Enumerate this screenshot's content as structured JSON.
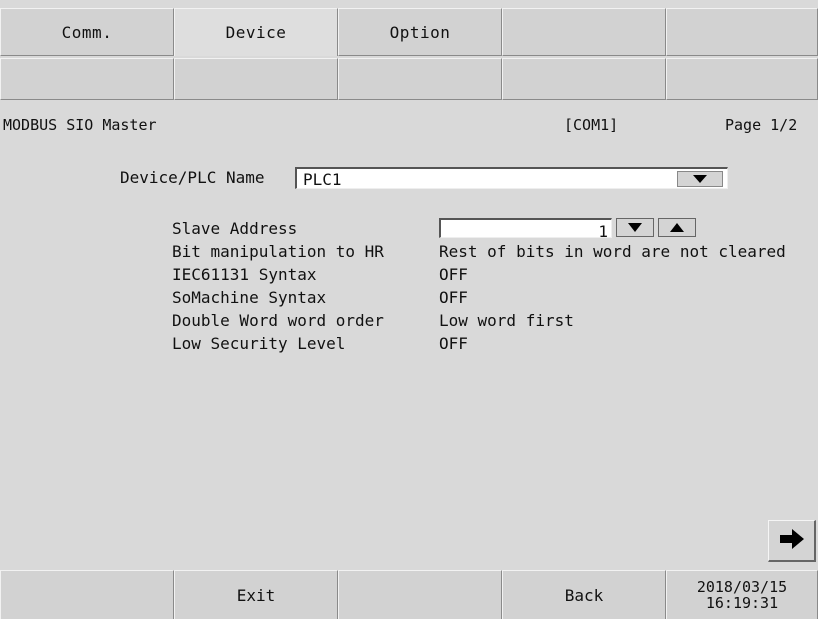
{
  "tabs": [
    {
      "label": "Comm.",
      "active": false
    },
    {
      "label": "Device",
      "active": true
    },
    {
      "label": "Option",
      "active": false
    },
    {
      "label": "",
      "active": false
    },
    {
      "label": "",
      "active": false
    }
  ],
  "header": {
    "driver": "MODBUS SIO Master",
    "port": "[COM1]",
    "page": "Page 1/2"
  },
  "device": {
    "label": "Device/PLC Name",
    "value": "PLC1",
    "dropdown_icon": "triangle-down-icon"
  },
  "properties": [
    {
      "key": "Slave Address",
      "value": "1"
    },
    {
      "key": "Bit manipulation to HR",
      "value": "Rest of bits in word are not cleared"
    },
    {
      "key": "IEC61131 Syntax",
      "value": "OFF"
    },
    {
      "key": "SoMachine Syntax",
      "value": "OFF"
    },
    {
      "key": "Double Word word order",
      "value": "Low word first"
    },
    {
      "key": "Low Security Level",
      "value": "OFF"
    }
  ],
  "footer": {
    "exit_label": "Exit",
    "back_label": "Back",
    "date": "2018/03/15",
    "time": "16:19:31"
  },
  "icons": {
    "next": "arrow-right-icon",
    "spin_down": "triangle-down-icon",
    "spin_up": "triangle-up-icon"
  }
}
